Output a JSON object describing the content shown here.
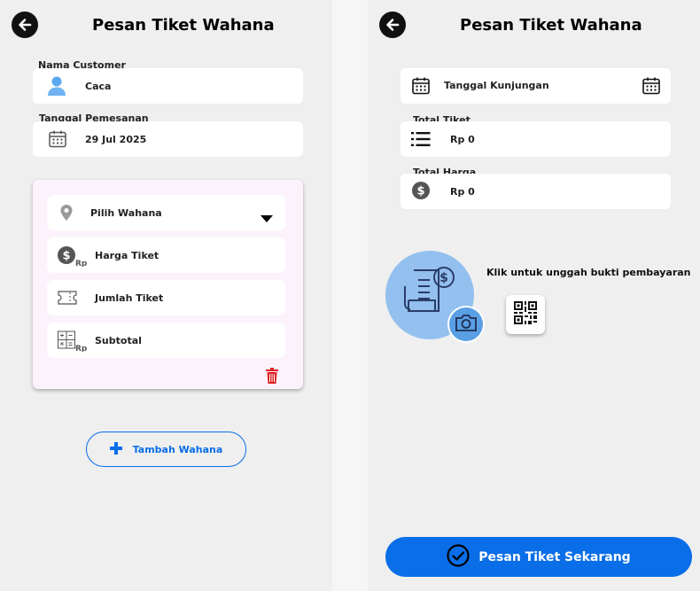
{
  "left": {
    "title": "Pesan Tiket Wahana",
    "customer": {
      "label": "Nama Customer",
      "value": "Caca",
      "icon": "user-icon"
    },
    "order_date": {
      "label": "Tanggal Pemesanan",
      "value": "29 Jul 2025",
      "icon": "calendar-icon"
    },
    "ride_card": {
      "select_placeholder": "Pilih Wahana",
      "price_label": "Harga Tiket",
      "price_prefix": "Rp",
      "qty_label": "Jumlah Tiket",
      "subtotal_label": "Subtotal",
      "subtotal_prefix": "Rp",
      "delete_color": "#e02020"
    },
    "add_button": "Tambah Wahana"
  },
  "right": {
    "title": "Pesan Tiket Wahana",
    "visit_date_placeholder": "Tanggal Kunjungan",
    "total_tickets": {
      "label": "Total Tiket",
      "value": "Rp 0"
    },
    "total_price": {
      "label": "Total Harga",
      "value": "Rp 0"
    },
    "upload_text": "Klik untuk unggah bukti pembayaran",
    "submit_button": "Pesan Tiket Sekarang"
  },
  "colors": {
    "accent": "#0a6ee8",
    "card_bg": "#fbf2fb",
    "upload_circle": "#93c0ee"
  }
}
